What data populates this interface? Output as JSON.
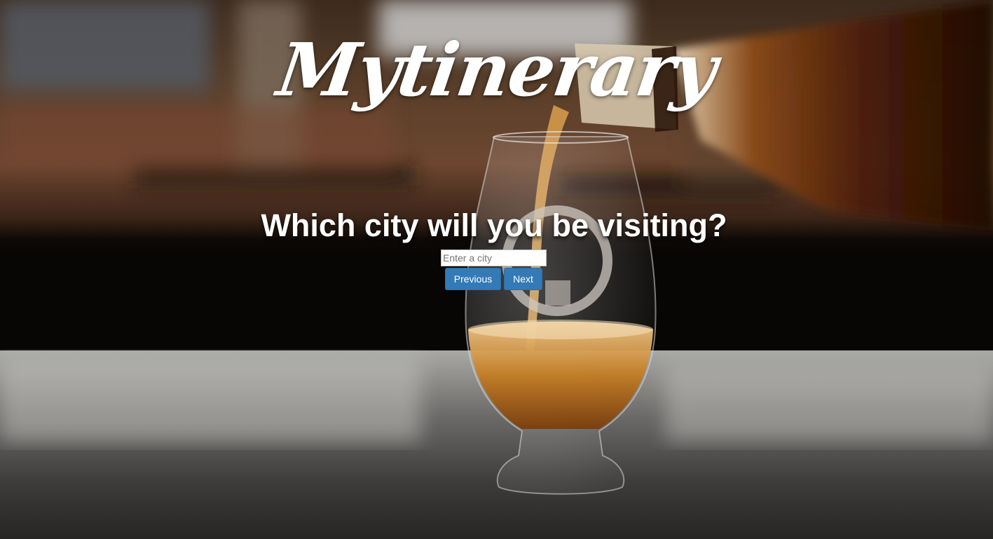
{
  "brand": {
    "logo_text": "Mytinerary"
  },
  "main": {
    "question": "Which city will you be visiting?",
    "city_input": {
      "placeholder": "Enter a city",
      "value": ""
    },
    "buttons": {
      "previous_label": "Previous",
      "next_label": "Next"
    }
  },
  "colors": {
    "button_primary": "#337ab7",
    "button_border": "#2e6da4",
    "text_on_background": "#ffffff"
  },
  "background": {
    "icon": "whisky-glass-pour-photo"
  }
}
